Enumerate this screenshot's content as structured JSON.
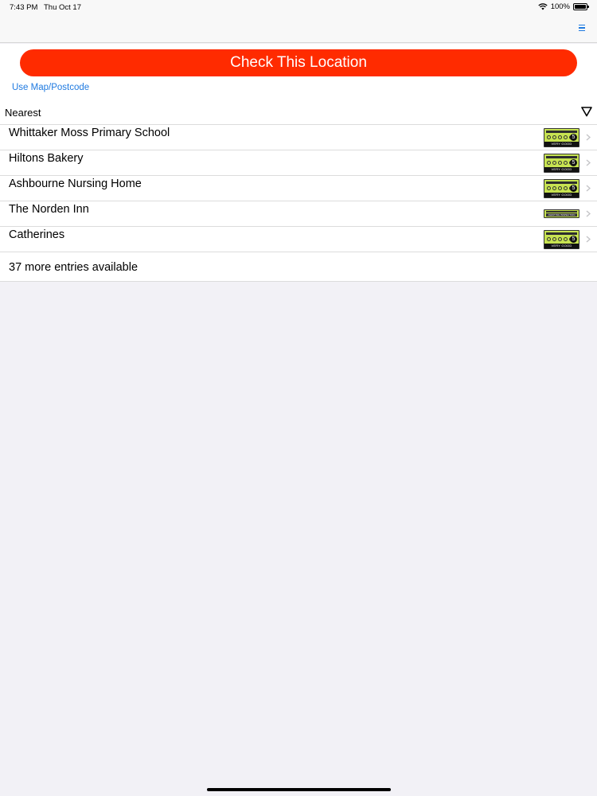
{
  "status_bar": {
    "time": "7:43 PM",
    "date": "Thu Oct 17",
    "battery": "100%",
    "icons": [
      "wifi-icon",
      "battery-icon"
    ]
  },
  "nav": {
    "menu_icon": "menu-icon",
    "accent": "#1f7ae0"
  },
  "check": {
    "label": "Check This Location",
    "color": "#ff2b00"
  },
  "map_link": "Use Map/Postcode",
  "sort": {
    "label": "Nearest",
    "icon": "filter-triangle-icon"
  },
  "places": [
    {
      "name": "Whittaker Moss Primary School",
      "rating": "5",
      "rating_text": "VERY GOOD"
    },
    {
      "name": "Hiltons Bakery",
      "rating": "5",
      "rating_text": "VERY GOOD"
    },
    {
      "name": "Ashbourne Nursing Home",
      "rating": "5",
      "rating_text": "VERY GOOD"
    },
    {
      "name": "The Norden Inn",
      "rating": "",
      "rating_text": "AWAITING INSPECTION"
    },
    {
      "name": "Catherines",
      "rating": "5",
      "rating_text": "VERY GOOD"
    }
  ],
  "more_entries": "37 more entries available"
}
